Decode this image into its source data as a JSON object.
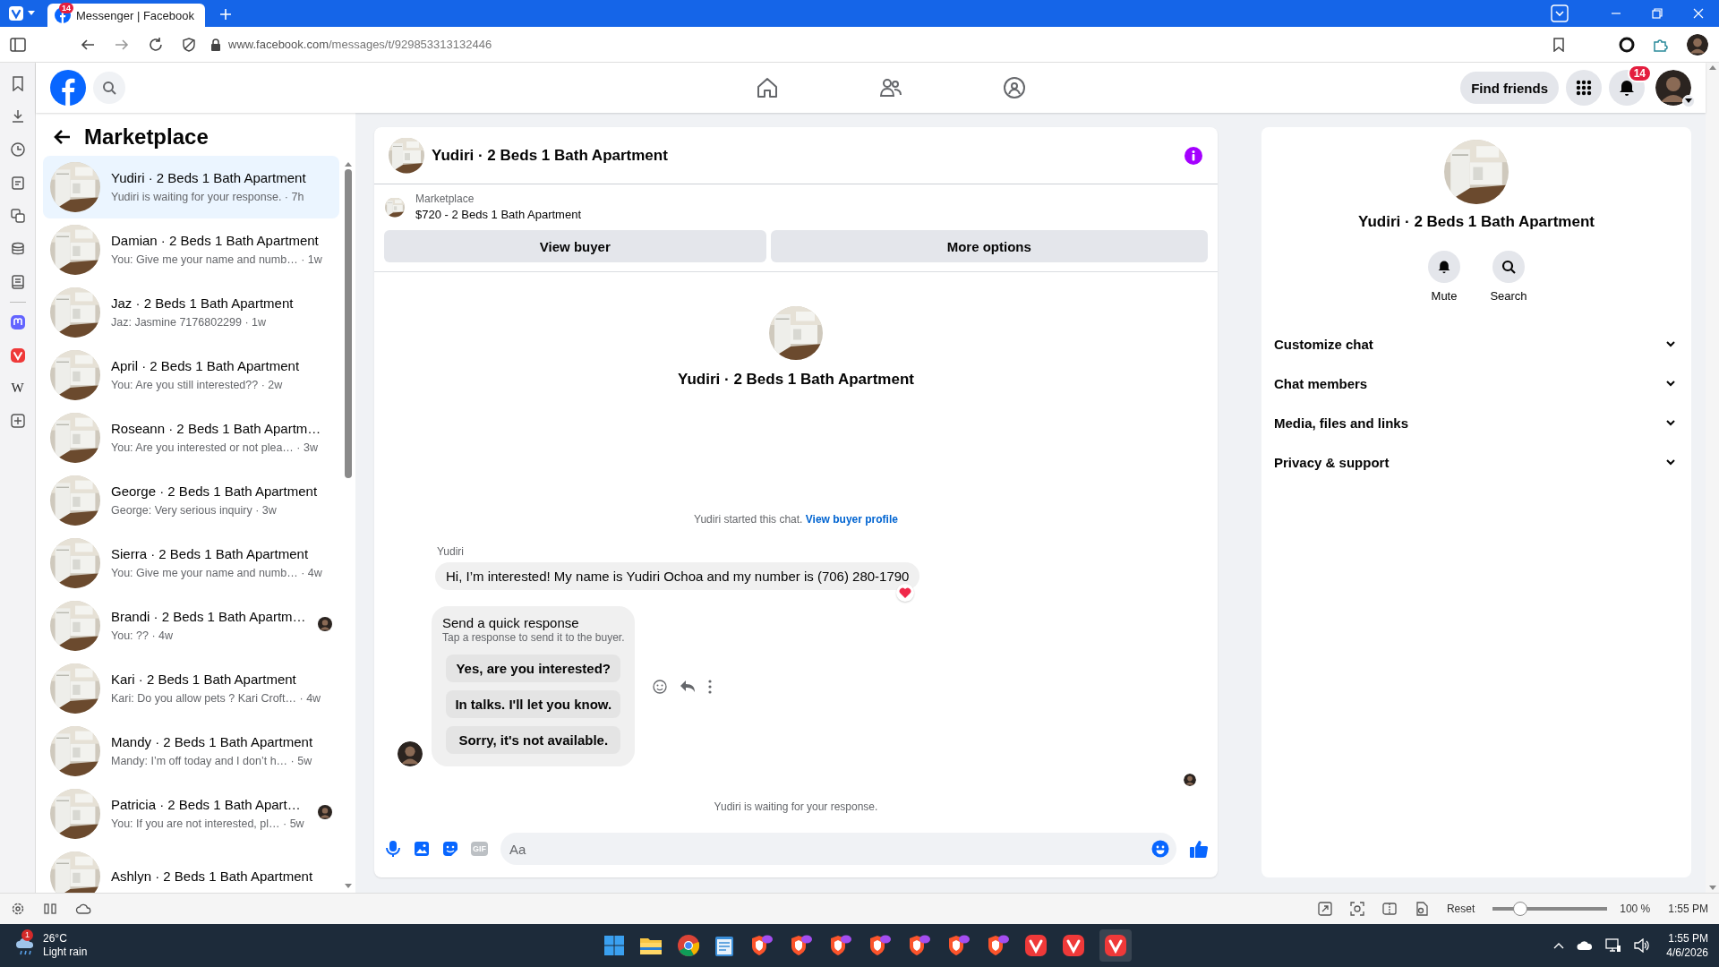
{
  "browser": {
    "tab": {
      "badge": "14",
      "title": "Messenger | Facebook",
      "selected": true
    },
    "address": {
      "host": "www.facebook.com",
      "path": "/messages/t/929853313132446"
    }
  },
  "panel": {
    "wiki_label": "W"
  },
  "topnav": {
    "find_friends": "Find friends",
    "notifications_badge": "14"
  },
  "inbox": {
    "title": "Marketplace",
    "conversations": [
      {
        "title": "Yudiri · 2 Beds 1 Bath Apartment",
        "snippet": "Yudiri is waiting for your response. · 7h",
        "selected": true,
        "seen": false
      },
      {
        "title": "Damian · 2 Beds 1 Bath Apartment",
        "snippet": "You: Give me your name and numb… · 1w",
        "selected": false,
        "seen": false
      },
      {
        "title": "Jaz · 2 Beds 1 Bath Apartment",
        "snippet": "Jaz: Jasmine 7176802299 · 1w",
        "selected": false,
        "seen": false
      },
      {
        "title": "April · 2 Beds 1 Bath Apartment",
        "snippet": "You: Are you still interested?? · 2w",
        "selected": false,
        "seen": false
      },
      {
        "title": "Roseann · 2 Beds 1 Bath Apartm…",
        "snippet": "You: Are you interested or not plea… · 3w",
        "selected": false,
        "seen": false
      },
      {
        "title": "George · 2 Beds 1 Bath Apartment",
        "snippet": "George: Very serious inquiry · 3w",
        "selected": false,
        "seen": false
      },
      {
        "title": "Sierra · 2 Beds 1 Bath Apartment",
        "snippet": "You: Give me your name and numb… · 4w",
        "selected": false,
        "seen": false
      },
      {
        "title": "Brandi · 2 Beds 1 Bath Apartm…",
        "snippet": "You: ?? · 4w",
        "selected": false,
        "seen": true
      },
      {
        "title": "Kari · 2 Beds 1 Bath Apartment",
        "snippet": "Kari: Do you allow pets ? Kari Croft… · 4w",
        "selected": false,
        "seen": false
      },
      {
        "title": "Mandy · 2 Beds 1 Bath Apartment",
        "snippet": "Mandy: I’m off today and I don’t h… · 5w",
        "selected": false,
        "seen": false
      },
      {
        "title": "Patricia · 2 Beds 1 Bath Apart…",
        "snippet": "You: If you are not interested, pl… · 5w",
        "selected": false,
        "seen": true
      },
      {
        "title": "Ashlyn · 2 Beds 1 Bath Apartment",
        "selected": false,
        "seen": false
      }
    ]
  },
  "chat": {
    "title": "Yudiri · 2 Beds 1 Bath Apartment",
    "listing": {
      "label": "Marketplace",
      "name": "$720 - 2 Beds 1 Bath Apartment"
    },
    "actions": [
      "View buyer",
      "More options"
    ],
    "intro_name": "Yudiri · 2 Beds 1 Bath Apartment",
    "started": {
      "text": "Yudiri started this chat.",
      "link": "View buyer profile"
    },
    "message": {
      "sender": "Yudiri",
      "text": "Hi, I’m interested! My name is Yudiri Ochoa and my number is (706) 280-1790",
      "reacted": true
    },
    "quick_response": {
      "title": "Send a quick response",
      "hint": "Tap a response to send it to the buyer.",
      "options": [
        "Yes, are you interested?",
        "In talks. I'll let you know.",
        "Sorry, it's not available."
      ]
    },
    "status": "Yudiri is waiting for your response.",
    "composer": {
      "placeholder": "Aa",
      "gif_label": "GIF"
    }
  },
  "details": {
    "name": "Yudiri · 2 Beds 1 Bath Apartment",
    "actions": [
      {
        "label": "Mute",
        "kind": "bell"
      },
      {
        "label": "Search",
        "kind": "search"
      }
    ],
    "sections": [
      {
        "label": "Customize chat",
        "expanded": false
      },
      {
        "label": "Chat members",
        "expanded": false
      },
      {
        "label": "Media, files and links",
        "expanded": false
      },
      {
        "label": "Privacy & support",
        "expanded": false
      }
    ]
  },
  "status_bar": {
    "reset": "Reset",
    "zoom_slider": {
      "level": 0.2
    },
    "zoom": "100 %",
    "time": "1:55 PM"
  },
  "taskbar": {
    "weather": {
      "badge": "1",
      "temp": "26°C",
      "condition": "Light rain"
    },
    "clock": {
      "time": "1:55 PM",
      "date": "4/6/2026"
    }
  }
}
